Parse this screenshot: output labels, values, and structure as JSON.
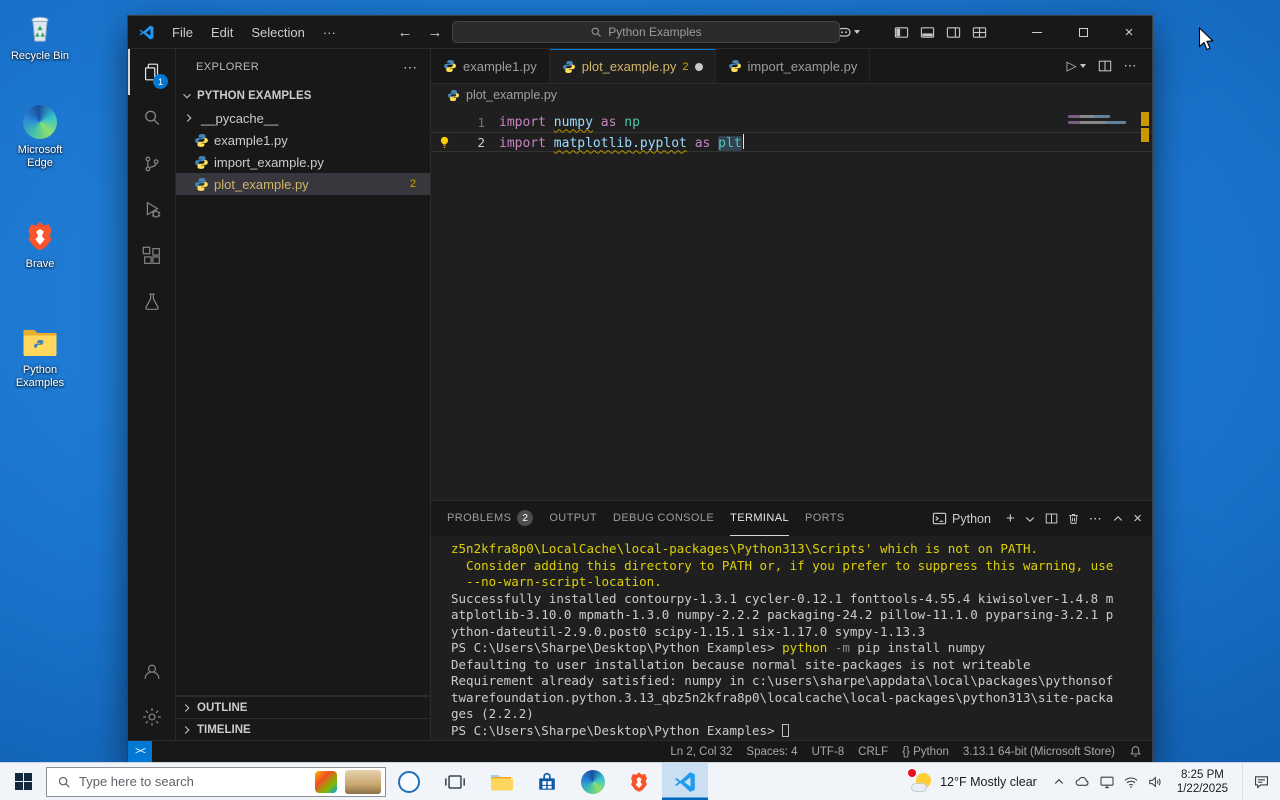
{
  "colors": {
    "accent": "#0078d4",
    "warning": "#cca700",
    "editor_bg": "#1f1f1f",
    "taskbar_bg": "#f1f4f8"
  },
  "desktop": {
    "icons": [
      {
        "label": "Recycle Bin"
      },
      {
        "label": "Microsoft Edge"
      },
      {
        "label": "Brave"
      },
      {
        "label": "Python Examples"
      }
    ]
  },
  "titlebar": {
    "menus": [
      "File",
      "Edit",
      "Selection"
    ],
    "more": "···",
    "search": "Python Examples"
  },
  "activity": {
    "explorer_badge": "1"
  },
  "explorer": {
    "header": "EXPLORER",
    "section": "PYTHON EXAMPLES",
    "files": [
      {
        "label": "__pycache__",
        "kind": "folder"
      },
      {
        "label": "example1.py",
        "kind": "python"
      },
      {
        "label": "import_example.py",
        "kind": "python"
      },
      {
        "label": "plot_example.py",
        "kind": "python",
        "selected": true,
        "badge": "2"
      }
    ],
    "outline": "OUTLINE",
    "timeline": "TIMELINE"
  },
  "editor": {
    "tabs": [
      {
        "label": "example1.py"
      },
      {
        "label": "plot_example.py",
        "badge": "2",
        "dirty": true,
        "active": true
      },
      {
        "label": "import_example.py"
      }
    ],
    "breadcrumb": "plot_example.py",
    "code": [
      {
        "n": "1",
        "tokens": [
          {
            "t": "import",
            "c": "kw"
          },
          {
            "t": " ",
            "c": "pl"
          },
          {
            "t": "numpy",
            "c": "mod",
            "sq": true
          },
          {
            "t": " ",
            "c": "pl"
          },
          {
            "t": "as",
            "c": "kw"
          },
          {
            "t": " ",
            "c": "pl"
          },
          {
            "t": "np",
            "c": "alias"
          }
        ]
      },
      {
        "n": "2",
        "current": true,
        "lightbulb": true,
        "cursor": true,
        "tokens": [
          {
            "t": "import",
            "c": "kw"
          },
          {
            "t": " ",
            "c": "pl"
          },
          {
            "t": "matplotlib.pyplot",
            "c": "mod",
            "sq": true
          },
          {
            "t": " ",
            "c": "pl"
          },
          {
            "t": "as",
            "c": "kw"
          },
          {
            "t": " ",
            "c": "pl"
          },
          {
            "t": "plt",
            "c": "alias",
            "hl": true
          }
        ]
      }
    ]
  },
  "panel": {
    "tabs": [
      {
        "label": "PROBLEMS",
        "badge": "2"
      },
      {
        "label": "OUTPUT"
      },
      {
        "label": "DEBUG CONSOLE"
      },
      {
        "label": "TERMINAL",
        "active": true
      },
      {
        "label": "PORTS"
      }
    ],
    "shell_label": "Python",
    "terminal": [
      [
        {
          "t": "z5n2kfra8p0\\LocalCache\\local-packages\\Python313\\Scripts' which is not on PATH.",
          "c": "y"
        }
      ],
      [
        {
          "t": "  Consider adding this directory to PATH or, if you prefer to suppress this warning, use",
          "c": "y"
        }
      ],
      [
        {
          "t": "  --no-warn-script-location.",
          "c": "y"
        }
      ],
      [
        {
          "t": "Successfully installed contourpy-1.3.1 cycler-0.12.1 fonttools-4.55.4 kiwisolver-1.4.8 m",
          "c": "d"
        }
      ],
      [
        {
          "t": "atplotlib-3.10.0 mpmath-1.3.0 numpy-2.2.2 packaging-24.2 pillow-11.1.0 pyparsing-3.2.1 p",
          "c": "d"
        }
      ],
      [
        {
          "t": "ython-dateutil-2.9.0.post0 scipy-1.15.1 six-1.17.0 sympy-1.13.3",
          "c": "d"
        }
      ],
      [
        {
          "t": "PS C:\\Users\\Sharpe\\Desktop\\Python Examples> ",
          "c": "d"
        },
        {
          "t": "python",
          "c": "y"
        },
        {
          "t": " -m",
          "c": "g"
        },
        {
          "t": " pip install numpy",
          "c": "d"
        }
      ],
      [
        {
          "t": "Defaulting to user installation because normal site-packages is not writeable",
          "c": "d"
        }
      ],
      [
        {
          "t": "Requirement already satisfied: numpy in c:\\users\\sharpe\\appdata\\local\\packages\\pythonsof",
          "c": "d"
        }
      ],
      [
        {
          "t": "twarefoundation.python.3.13_qbz5n2kfra8p0\\localcache\\local-packages\\python313\\site-packa",
          "c": "d"
        }
      ],
      [
        {
          "t": "ges (2.2.2)",
          "c": "d"
        }
      ],
      [
        {
          "t": "PS C:\\Users\\Sharpe\\Desktop\\Python Examples> ",
          "c": "d"
        },
        {
          "t": "",
          "c": "cursor"
        }
      ]
    ]
  },
  "status": {
    "items": [
      "Ln 2, Col 32",
      "Spaces: 4",
      "UTF-8",
      "CRLF",
      "{} Python",
      "3.13.1 64-bit (Microsoft Store)"
    ]
  },
  "taskbar": {
    "search_placeholder": "Type here to search",
    "weather_temp": "12°F",
    "weather_text": "Mostly clear",
    "time": "8:25 PM",
    "date": "1/22/2025"
  }
}
